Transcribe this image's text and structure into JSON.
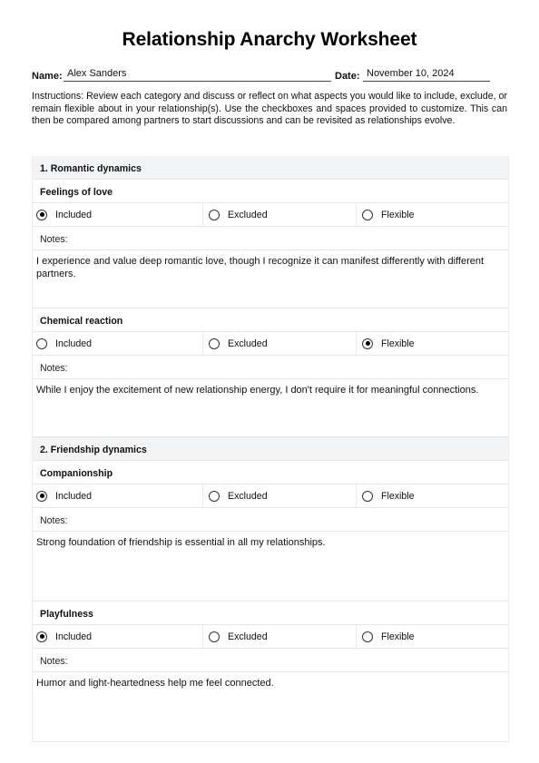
{
  "title": "Relationship Anarchy Worksheet",
  "meta": {
    "name_label": "Name:",
    "name_value": "Alex Sanders",
    "date_label": "Date:",
    "date_value": "November 10, 2024"
  },
  "instructions": "Instructions: Review each category and discuss or reflect on what aspects you would like to include, exclude, or remain flexible about in your relationship(s). Use the checkboxes and spaces provided to customize. This can then be compared among partners to start discussions and can be revisited as relationships evolve.",
  "option_labels": [
    "Included",
    "Excluded",
    "Flexible"
  ],
  "notes_label": "Notes:",
  "sections": [
    {
      "title": "1. Romantic dynamics",
      "items": [
        {
          "title": "Feelings of love",
          "selected": "Included",
          "notes": "I experience and value deep romantic love, though I recognize it can manifest differently with different partners."
        },
        {
          "title": "Chemical reaction",
          "selected": "Flexible",
          "notes": "While I enjoy the excitement of new relationship energy, I don't require it for meaningful connections."
        }
      ]
    },
    {
      "title": "2. Friendship dynamics",
      "items": [
        {
          "title": "Companionship",
          "selected": "Included",
          "notes": "Strong foundation of friendship is essential in all my relationships."
        },
        {
          "title": "Playfulness",
          "selected": "Included",
          "notes": "Humor and light-heartedness help me feel connected."
        }
      ]
    }
  ]
}
